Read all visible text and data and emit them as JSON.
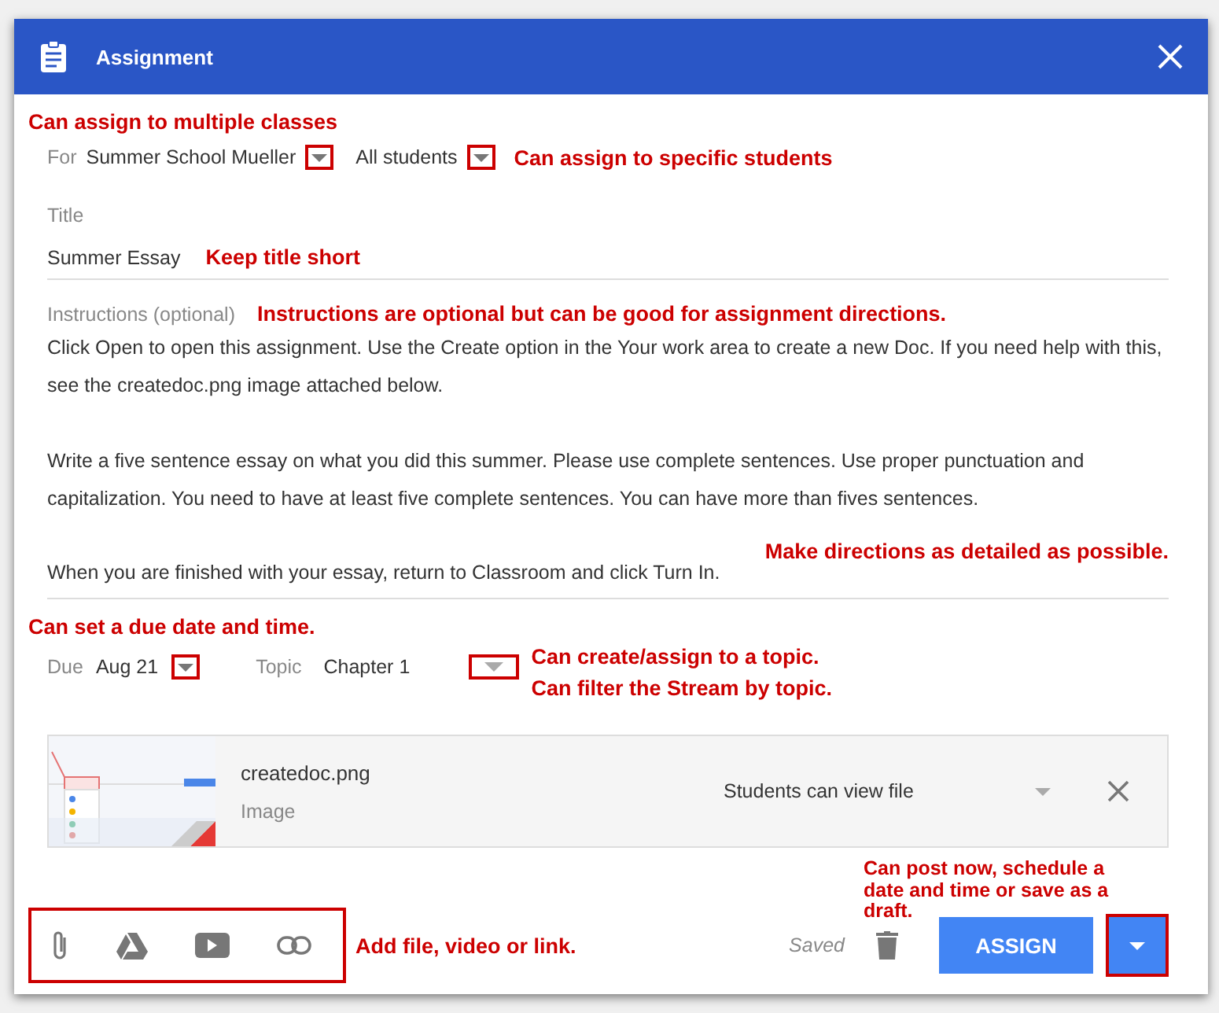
{
  "window": {
    "title": "Assignment"
  },
  "for_row": {
    "label": "For",
    "class": {
      "value": "Summer School Mueller",
      "outlined": true
    },
    "students": {
      "value": "All students",
      "outlined": true
    },
    "note_above": "Can assign to multiple classes",
    "note_beside": "Can assign to specific students"
  },
  "title_field": {
    "label": "Title",
    "value": "Summer Essay",
    "note": "Keep title short"
  },
  "instructions": {
    "label": "Instructions (optional)",
    "note": "Instructions are optional but can be good for assignment directions.",
    "paragraphs": [
      "Click Open to open this assignment. Use the Create option in the Your work area to create a new Doc. If you need help with this, see the createdoc.png image attached below.",
      "Write a five sentence essay on what you did this summer. Please use complete sentences. Use proper punctuation and capitalization. You need to have at least five complete sentences. You can have more than fives sentences.",
      "When you are finished with your essay, return to Classroom and click Turn In."
    ],
    "note_detail": "Make directions as detailed as possible."
  },
  "due_row": {
    "note_above": "Can set a due date and time.",
    "due_label": "Due",
    "due": {
      "value": "Aug 21",
      "outlined": true
    },
    "topic_label": "Topic",
    "topic": {
      "value": "Chapter 1",
      "outlined": true
    },
    "notes_beside": [
      "Can create/assign to a topic.",
      "Can filter the Stream by topic."
    ]
  },
  "attachment": {
    "name": "createdoc.png",
    "type": "Image",
    "permission": "Students can view file"
  },
  "footer": {
    "tools_outlined": true,
    "tools_note": "Add file, video or link.",
    "status": "Saved",
    "assign_button": "ASSIGN",
    "menu_outlined": true,
    "assign_note": "Can post now, schedule a date and time or save as a draft."
  }
}
